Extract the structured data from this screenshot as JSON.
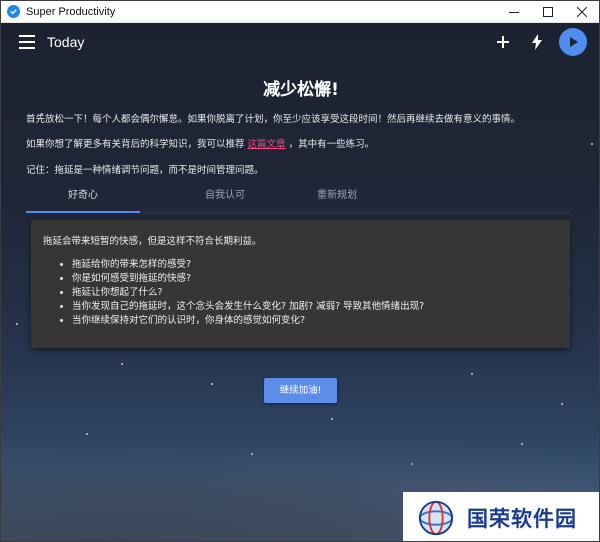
{
  "window": {
    "title": "Super Productivity"
  },
  "toolbar": {
    "view_title": "Today"
  },
  "content": {
    "heading": "减少松懈!",
    "para1": "首先放松一下！每个人都会偶尔懈怠。如果你脱离了计划，你至少应该享受这段时间！然后再继续去做有意义的事情。",
    "para2_before": "如果你想了解更多有关背后的科学知识，我可以推荐",
    "para2_link": "这篇文章",
    "para2_after": "，其中有一些练习。",
    "para3": "记住：拖延是一种情绪调节问题，而不是时间管理问题。"
  },
  "tabs": [
    {
      "label": "好奇心",
      "active": true
    },
    {
      "label": "自我认可",
      "active": false
    },
    {
      "label": "重新规划",
      "active": false
    }
  ],
  "card": {
    "intro": "拖延会带来短暂的快感，但是这样不符合长期利益。",
    "items": [
      "拖延给你的带来怎样的感受?",
      "你是如何感受到拖延的快感?",
      "拖延让你想起了什么?",
      "当你发现自己的拖延时，这个念头会发生什么变化? 加剧? 减弱? 导致其他情绪出现?",
      "当你继续保持对它们的认识时，你身体的感觉如何变化?"
    ]
  },
  "continue_button": "继续加油!",
  "watermark": "国荣软件园",
  "colors": {
    "accent": "#4d8ef0",
    "link": "#ff4081",
    "card": "#363636",
    "button": "#5b8de9"
  }
}
